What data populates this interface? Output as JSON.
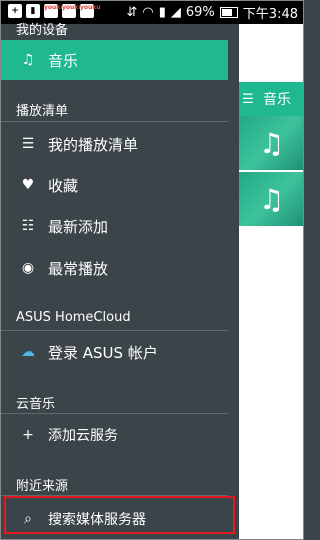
{
  "status_bar": {
    "battery": "69%",
    "time": "下午3:48",
    "icons": [
      "plus-icon",
      "sd-card-icon",
      "youku-icon",
      "youku-icon",
      "youku-icon",
      "usb-icon",
      "wifi-icon",
      "signal-icon",
      "battery-icon"
    ]
  },
  "drawer": {
    "sections": [
      {
        "title": "我的设备",
        "items": [
          {
            "label": "音乐",
            "icon": "music-note-icon",
            "active": true
          }
        ]
      },
      {
        "title": "播放清单",
        "items": [
          {
            "label": "我的播放清单",
            "icon": "list-icon"
          },
          {
            "label": "收藏",
            "icon": "heart-icon"
          },
          {
            "label": "最新添加",
            "icon": "list-add-icon"
          },
          {
            "label": "最常播放",
            "icon": "play-count-icon"
          }
        ]
      },
      {
        "title": "ASUS HomeCloud",
        "items": [
          {
            "label": "登录 ASUS 帐户",
            "icon": "cloud-icon"
          }
        ]
      },
      {
        "title": "云音乐",
        "items": [
          {
            "label": "添加云服务",
            "icon": "plus-icon"
          }
        ]
      },
      {
        "title": "附近来源",
        "items": [
          {
            "label": "搜索媒体服务器",
            "icon": "search-icon"
          }
        ]
      }
    ]
  },
  "right_panel": {
    "header_title": "音乐",
    "accent": "#1fb890"
  },
  "colors": {
    "drawer_bg": "#3b4448",
    "accent": "#1fb890",
    "highlight": "#e01a22"
  }
}
